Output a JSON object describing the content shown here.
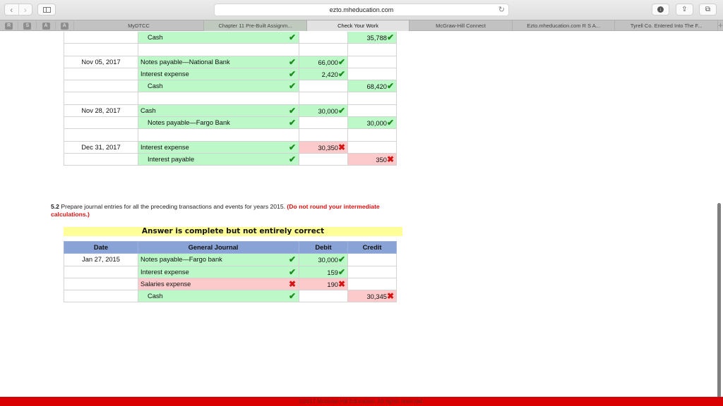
{
  "browser": {
    "url": "ezto.mheducation.com",
    "favorites": [
      "R",
      "S",
      "A",
      "A"
    ],
    "tabs": [
      {
        "label": "MyDTCC",
        "active": false
      },
      {
        "label": "Chapter 11 Pre-Built Assignm...",
        "active": false
      },
      {
        "label": "Check Your Work",
        "active": true
      },
      {
        "label": "McGraw-Hill Connect",
        "active": false
      },
      {
        "label": "Ezto.mheducation.com R S A...",
        "active": false
      },
      {
        "label": "Tyrell Co. Entered Into The F...",
        "active": false
      }
    ],
    "icons": {
      "back": "‹",
      "forward": "›",
      "reload": "↻",
      "download": "↓",
      "share": "⇪",
      "tabs": "⧉",
      "add_tab": "+"
    }
  },
  "journal_top": {
    "rows": [
      {
        "date": "",
        "account": "Cash",
        "indent": true,
        "account_status": "ok",
        "debit": "",
        "debit_status": "",
        "credit": "35,788",
        "credit_status": "ok"
      },
      {
        "blank": true
      },
      {
        "date": "Nov 05, 2017",
        "account": "Notes payable—National Bank",
        "indent": false,
        "account_status": "ok",
        "debit": "66,000",
        "debit_status": "ok",
        "credit": "",
        "credit_status": ""
      },
      {
        "date": "",
        "account": "Interest expense",
        "indent": false,
        "account_status": "ok",
        "debit": "2,420",
        "debit_status": "ok",
        "credit": "",
        "credit_status": ""
      },
      {
        "date": "",
        "account": "Cash",
        "indent": true,
        "account_status": "ok",
        "debit": "",
        "debit_status": "",
        "credit": "68,420",
        "credit_status": "ok"
      },
      {
        "blank": true
      },
      {
        "date": "Nov 28, 2017",
        "account": "Cash",
        "indent": false,
        "account_status": "ok",
        "debit": "30,000",
        "debit_status": "ok",
        "credit": "",
        "credit_status": ""
      },
      {
        "date": "",
        "account": "Notes payable—Fargo Bank",
        "indent": true,
        "account_status": "ok",
        "debit": "",
        "debit_status": "",
        "credit": "30,000",
        "credit_status": "ok"
      },
      {
        "blank": true
      },
      {
        "date": "Dec 31, 2017",
        "account": "Interest expense",
        "indent": false,
        "account_status": "ok",
        "debit": "30,350",
        "debit_status": "bad",
        "credit": "",
        "credit_status": ""
      },
      {
        "date": "",
        "account": "Interest payable",
        "indent": true,
        "account_status": "ok",
        "debit": "",
        "debit_status": "",
        "credit": "350",
        "credit_status": "bad"
      }
    ]
  },
  "question": {
    "number": "5.2",
    "text": "Prepare journal entries for all the preceding transactions and events for years 2015.",
    "note": "(Do not round your intermediate calculations.)"
  },
  "banner": "Answer is complete but not entirely correct",
  "journal_bottom": {
    "headers": [
      "Date",
      "General Journal",
      "Debit",
      "Credit"
    ],
    "rows": [
      {
        "date": "Jan 27, 2015",
        "account": "Notes payable—Fargo bank",
        "indent": false,
        "account_status": "ok",
        "debit": "30,000",
        "debit_status": "ok",
        "credit": "",
        "credit_status": ""
      },
      {
        "date": "",
        "account": "Interest expense",
        "indent": false,
        "account_status": "ok",
        "debit": "159",
        "debit_status": "ok",
        "credit": "",
        "credit_status": ""
      },
      {
        "date": "",
        "account": "Salaries expense",
        "indent": false,
        "account_status": "bad",
        "debit": "190",
        "debit_status": "bad",
        "credit": "",
        "credit_status": ""
      },
      {
        "date": "",
        "account": "Cash",
        "indent": true,
        "account_status": "ok",
        "debit": "",
        "debit_status": "",
        "credit": "30,345",
        "credit_status": "bad"
      }
    ]
  },
  "marks": {
    "ok": "✔",
    "bad": "✖"
  },
  "colors": {
    "correct_bg": "#bcf8c8",
    "incorrect_bg": "#fccaca",
    "header_bg": "#8aa3d6",
    "banner_bg": "#ffff9a",
    "footer_bg": "#d90000"
  },
  "footer": "©2017 McGraw-Hill Education. All rights reserved."
}
